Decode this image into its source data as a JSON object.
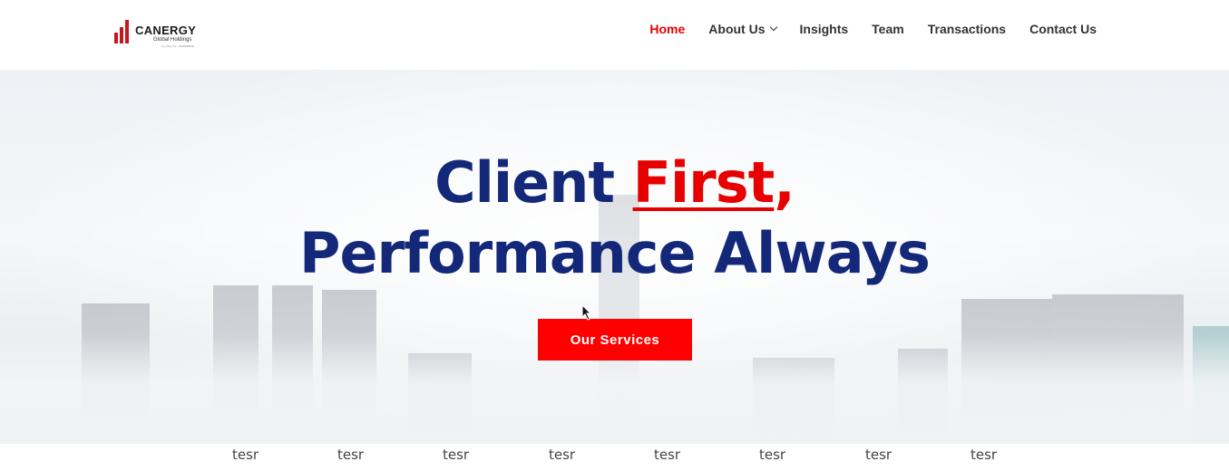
{
  "header": {
    "logo": {
      "wordmark": "CANERGY",
      "subtitle": "Global Holdings",
      "tagline": "Co. Reg. No.: 202209066H"
    },
    "nav": [
      {
        "label": "Home",
        "active": true
      },
      {
        "label": "About Us",
        "has_dropdown": true
      },
      {
        "label": "Insights"
      },
      {
        "label": "Team"
      },
      {
        "label": "Transactions"
      },
      {
        "label": "Contact Us"
      }
    ]
  },
  "hero": {
    "headline_part1": "Client ",
    "headline_highlight": "First",
    "headline_comma": ",",
    "headline_line2": "Performance Always",
    "cta_label": "Our Services"
  },
  "bottom_items": [
    "tesr",
    "tesr",
    "tesr",
    "tesr",
    "tesr",
    "tesr",
    "tesr",
    "tesr"
  ],
  "colors": {
    "accent_red": "#e60000",
    "headline_navy": "#14287a",
    "button_red": "#ff0000"
  }
}
